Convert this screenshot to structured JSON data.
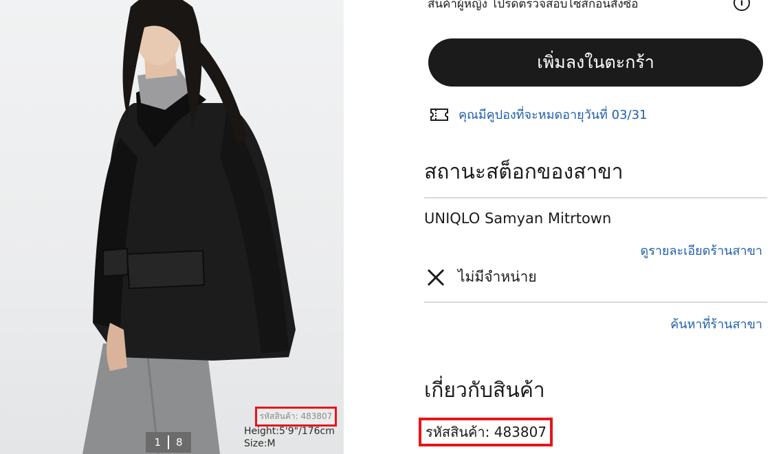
{
  "photo": {
    "sku_label": "รหัสสินค้า: 483807",
    "model_height": "Height:5'9\"/176cm",
    "model_size": "Size:M",
    "counter_current": "1",
    "counter_total": "8"
  },
  "header": {
    "note": "สินค้าผู้หญิง โปรดตรวจสอบไซส์ก่อนสั่งซื้อ",
    "info_icon": "info-icon"
  },
  "actions": {
    "add_to_cart_label": "เพิ่มลงในตะกร้า"
  },
  "coupon": {
    "icon": "ticket-icon",
    "text": "คุณมีคูปองที่จะหมดอายุวันที่ 03/31"
  },
  "stock": {
    "heading": "สถานะสต็อกของสาขา",
    "store_name": "UNIQLO Samyan Mitrtown",
    "store_detail_link": "ดูรายละเอียดร้านสาขา",
    "status_icon": "close-icon",
    "status_text": "ไม่มีจำหน่าย",
    "find_store_link": "ค้นหาที่ร้านสาขา"
  },
  "about": {
    "heading": "เกี่ยวกับสินค้า",
    "sku_label": "รหัสสินค้า: 483807"
  },
  "colors": {
    "button_bg": "#1b1b1b",
    "link": "#1f5eab",
    "highlight_border": "#e8141b"
  }
}
